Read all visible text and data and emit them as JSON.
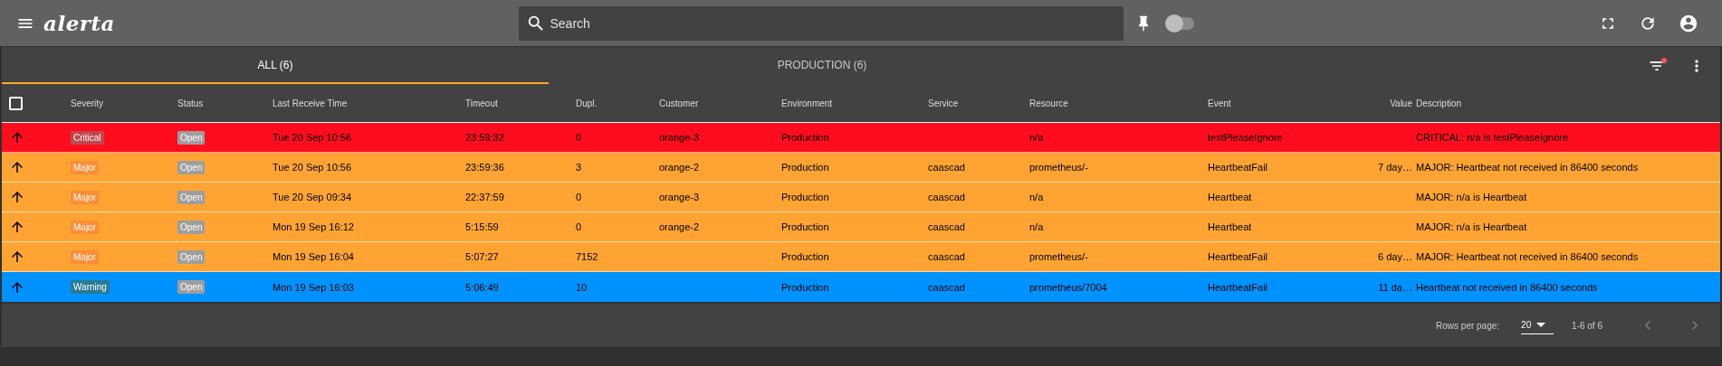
{
  "app_bar": {
    "logo": "alerta",
    "search": {
      "placeholder": "Search"
    },
    "pin_toggle": {
      "on": false
    }
  },
  "tabs": [
    {
      "label": "ALL (6)",
      "selected": true
    },
    {
      "label": "PRODUCTION (6)",
      "selected": false
    }
  ],
  "filter": {
    "active": true
  },
  "table": {
    "select_all": {
      "checked": false
    },
    "columns": [
      "Severity",
      "Status",
      "Last Receive Time",
      "Timeout",
      "Dupl.",
      "Customer",
      "Environment",
      "Service",
      "Resource",
      "Event",
      "Value",
      "Description"
    ],
    "rows": [
      {
        "kind": "critical",
        "severity": "Critical",
        "status": "Open",
        "last_receive_time": "Tue 20 Sep 10:56",
        "timeout": "23:59:32",
        "dupl": "0",
        "customer": "orange-3",
        "environment": "Production",
        "service": "",
        "resource": "n/a",
        "event": "testPleaseIgnore",
        "value": "",
        "description": "CRITICAL: n/a is testPleaseIgnore"
      },
      {
        "kind": "major",
        "severity": "Major",
        "status": "Open",
        "last_receive_time": "Tue 20 Sep 10:56",
        "timeout": "23:59:36",
        "dupl": "3",
        "customer": "orange-2",
        "environment": "Production",
        "service": "caascad",
        "resource": "prometheus/-",
        "event": "HeartbeatFail",
        "value": "7 day…",
        "description": "MAJOR: Heartbeat not received in 86400 seconds"
      },
      {
        "kind": "major",
        "severity": "Major",
        "status": "Open",
        "last_receive_time": "Tue 20 Sep 09:34",
        "timeout": "22:37:59",
        "dupl": "0",
        "customer": "orange-3",
        "environment": "Production",
        "service": "caascad",
        "resource": "n/a",
        "event": "Heartbeat",
        "value": "",
        "description": "MAJOR: n/a is Heartbeat"
      },
      {
        "kind": "major",
        "severity": "Major",
        "status": "Open",
        "last_receive_time": "Mon 19 Sep 16:12",
        "timeout": "5:15:59",
        "dupl": "0",
        "customer": "orange-2",
        "environment": "Production",
        "service": "caascad",
        "resource": "n/a",
        "event": "Heartbeat",
        "value": "",
        "description": "MAJOR: n/a is Heartbeat"
      },
      {
        "kind": "major",
        "severity": "Major",
        "status": "Open",
        "last_receive_time": "Mon 19 Sep 16:04",
        "timeout": "5:07:27",
        "dupl": "7152",
        "customer": "",
        "environment": "Production",
        "service": "caascad",
        "resource": "prometheus/-",
        "event": "HeartbeatFail",
        "value": "6 day…",
        "description": "MAJOR: Heartbeat not received in 86400 seconds"
      },
      {
        "kind": "warning",
        "severity": "Warning",
        "status": "Open",
        "last_receive_time": "Mon 19 Sep 16:03",
        "timeout": "5:06:49",
        "dupl": "10",
        "customer": "",
        "environment": "Production",
        "service": "caascad",
        "resource": "prometheus/7004",
        "event": "HeartbeatFail",
        "value": "11 da…",
        "description": "Heartbeat not received in 86400 seconds"
      }
    ]
  },
  "pagination": {
    "rows_per_page_label": "Rows per page:",
    "rows_per_page": "20",
    "range": "1-6 of 6",
    "prev_disabled": true,
    "next_disabled": true
  }
}
